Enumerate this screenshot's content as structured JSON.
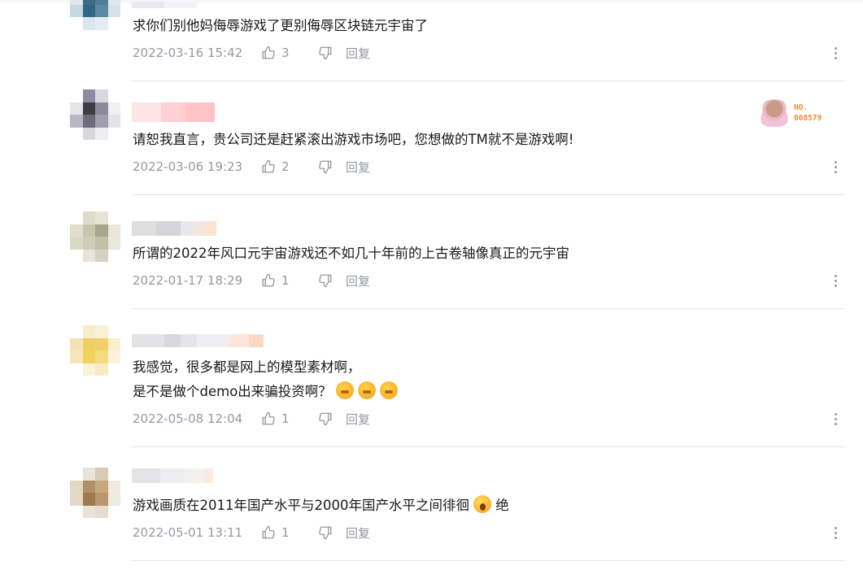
{
  "comments": [
    {
      "text_lines": [
        "求你们别他妈侮辱游戏了更别侮辱区块链元宇宙了"
      ],
      "time": "2022-03-16 15:42",
      "likes": "3"
    },
    {
      "text_lines": [
        "请恕我直言，贵公司还是赶紧滚出游戏市场吧，您想做的TM就不是游戏啊!"
      ],
      "time": "2022-03-06 19:23",
      "likes": "2",
      "badge": {
        "line1": "NO.",
        "line2": "008579"
      }
    },
    {
      "text_lines": [
        "所谓的2022年风口元宇宙游戏还不如几十年前的上古卷轴像真正的元宇宙"
      ],
      "time": "2022-01-17 18:29",
      "likes": "1"
    },
    {
      "text_lines": [
        "我感觉，很多都是网上的模型素材啊，",
        "是不是做个demo出来骗投资啊？"
      ],
      "time": "2022-05-08 12:04",
      "likes": "1"
    },
    {
      "text_lines": [
        "游戏画质在2011年国产水平与2000年国产水平之间徘徊",
        "绝"
      ],
      "time": "2022-05-01 13:11",
      "likes": "1"
    }
  ],
  "reply_label": "回复",
  "icons": {
    "like": "thumbs-up-icon",
    "dislike": "thumbs-down-icon",
    "more": "more-vertical-icon"
  },
  "colors": {
    "meta": "#9499a0",
    "divider": "#e3e5e7",
    "badge": "#f08a3c"
  }
}
